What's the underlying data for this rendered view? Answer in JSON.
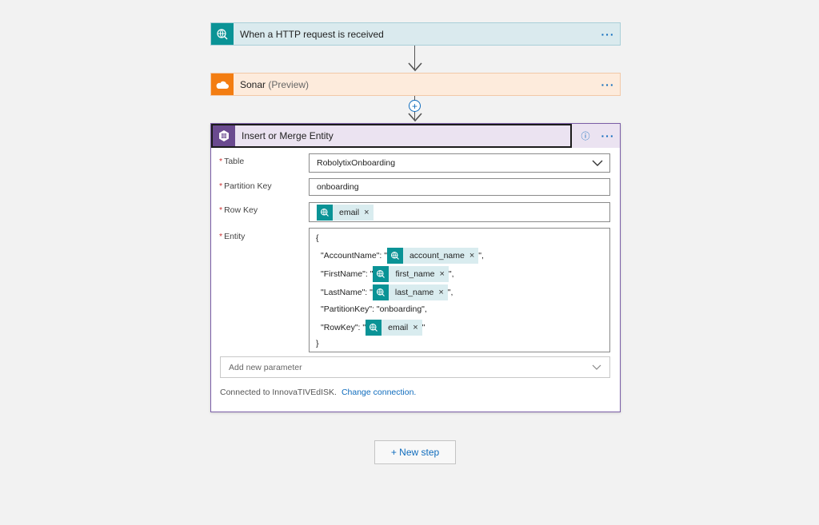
{
  "trigger": {
    "title": "When a HTTP request is received",
    "more": "···"
  },
  "sonar": {
    "title": "Sonar",
    "subtitle": "(Preview)",
    "more": "···"
  },
  "insert_step": {
    "plus": "+"
  },
  "action": {
    "title": "Insert or Merge Entity",
    "info": "ⓘ",
    "more": "···",
    "required_mark": "*",
    "table": {
      "label": "Table",
      "value": "RobolytixOnboarding"
    },
    "partition_key": {
      "label": "Partition Key",
      "value": "onboarding"
    },
    "row_key": {
      "label": "Row Key",
      "token": "email"
    },
    "entity": {
      "label": "Entity",
      "open": "{",
      "close": "}",
      "lines": [
        {
          "prefix": "\"AccountName\": \"",
          "token": "account_name",
          "suffix": "\","
        },
        {
          "prefix": "\"FirstName\": \"",
          "token": "first_name",
          "suffix": "\","
        },
        {
          "prefix": "\"LastName\": \"",
          "token": "last_name",
          "suffix": "\","
        },
        {
          "text": "\"PartitionKey\": \"onboarding\","
        },
        {
          "prefix": "\"RowKey\": \"",
          "token": "email",
          "suffix": "\""
        }
      ]
    },
    "add_param_placeholder": "Add new parameter",
    "connection_text": "Connected to InnovaTIVEdISK.",
    "change_connection": "Change connection."
  },
  "new_step": "+ New step",
  "token_remove": "×",
  "colors": {
    "accent": "#0f6cbd",
    "trigger": "#0a9396",
    "sonar": "#f37d12",
    "action": "#6a4a8f"
  },
  "icons": {
    "trigger": "globe-request-icon",
    "sonar": "cloud-icon",
    "action": "table-storage-icon"
  }
}
